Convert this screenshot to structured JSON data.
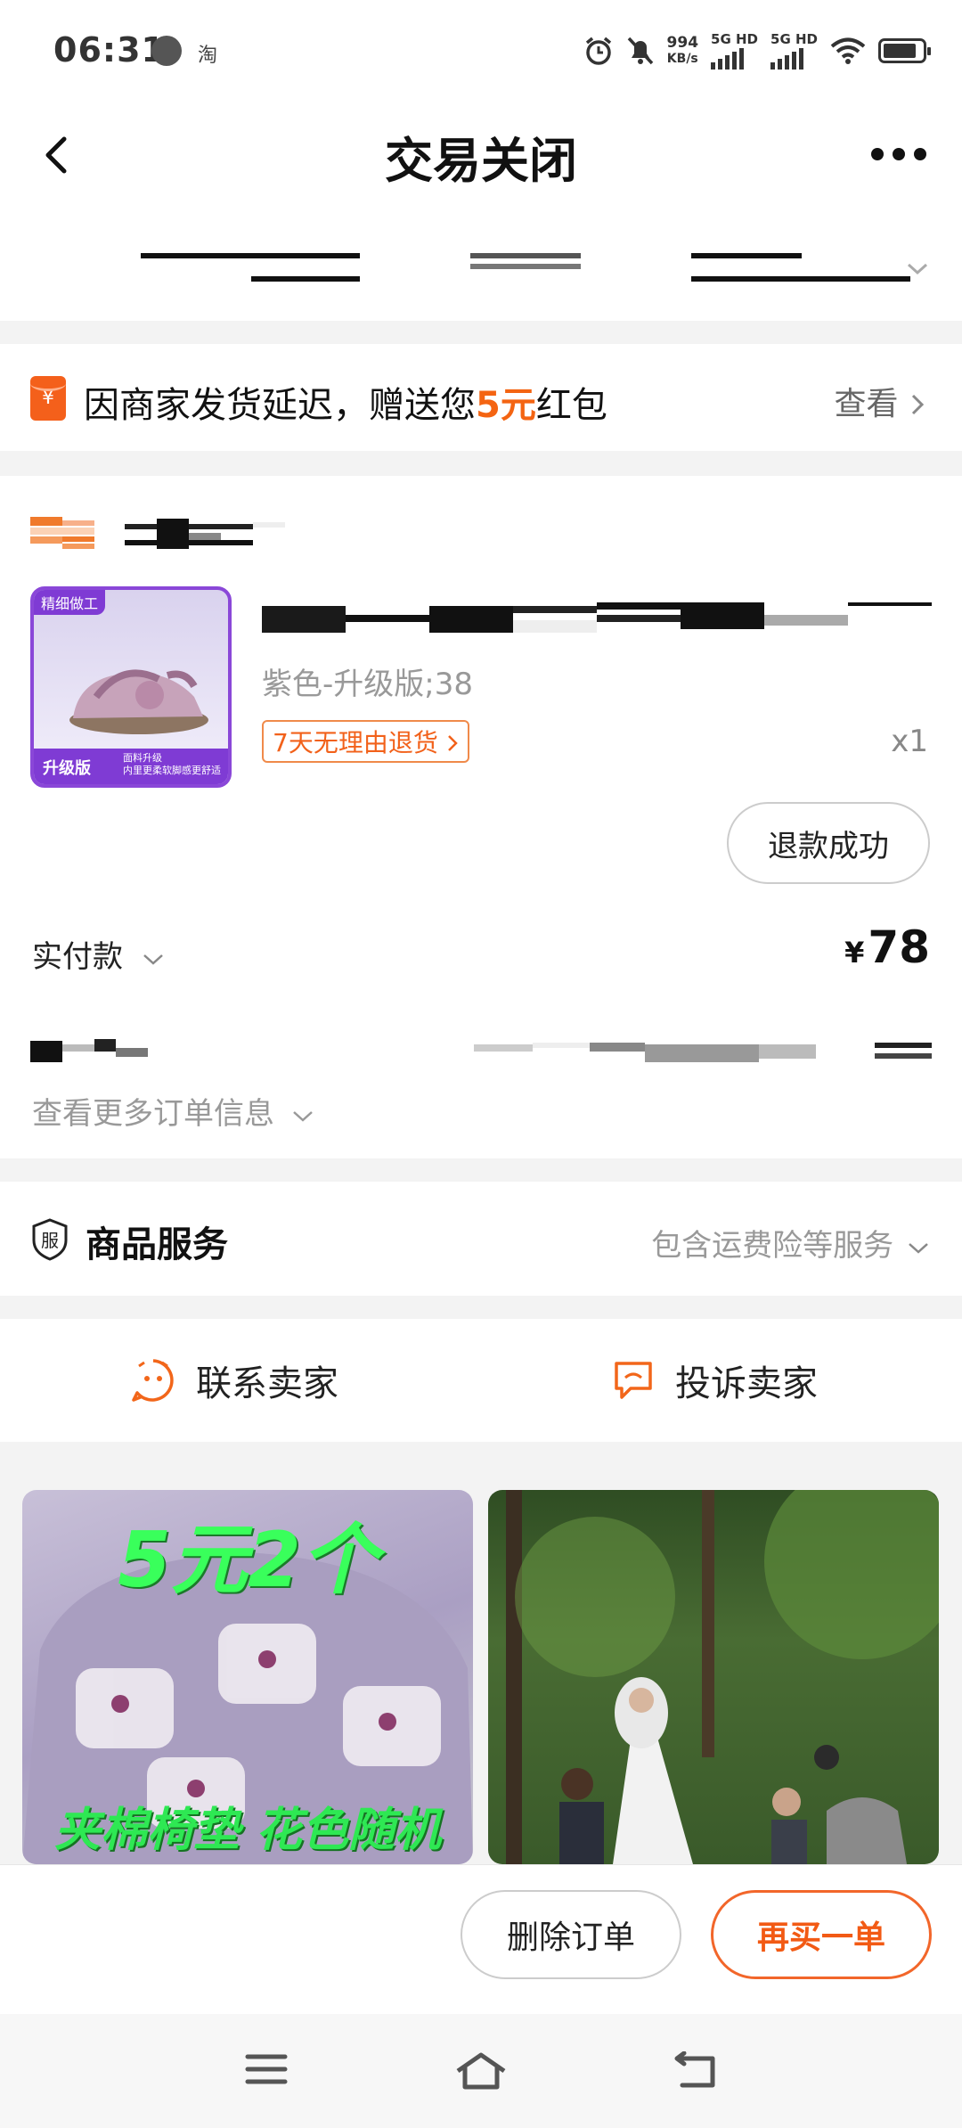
{
  "status_bar": {
    "time": "06:31",
    "app_badge": "淘",
    "net_speed": "994",
    "net_speed_unit": "KB/s",
    "sim1": "5G HD",
    "sim2": "5G HD"
  },
  "nav": {
    "title": "交易关闭"
  },
  "promo": {
    "text_prefix": "因商家发货延迟，赠送您",
    "amount": "5元",
    "text_suffix": "红包",
    "link": "查看",
    "icon_glyph": "¥"
  },
  "order": {
    "thumb_tag_top": "精细做工",
    "thumb_tag_bottom": "升级版",
    "thumb_tag_note_1": "面料升级",
    "thumb_tag_note_2": "内里更柔软脚感更舒适",
    "sku": "紫色-升级版;38",
    "return_policy": "7天无理由退货",
    "quantity": "x1",
    "refund_status": "退款成功",
    "paid_label": "实付款",
    "currency": "¥",
    "paid_amount": "78",
    "more_info": "查看更多订单信息"
  },
  "service": {
    "icon_glyph": "服",
    "title": "商品服务",
    "desc": "包含运费险等服务"
  },
  "contact": {
    "contact_seller": "联系卖家",
    "complain_seller": "投诉卖家"
  },
  "recommend": {
    "card1_top": "5元2个",
    "card1_bottom": "夹棉椅垫 花色随机"
  },
  "actions": {
    "delete_order": "删除订单",
    "buy_again": "再买一单"
  },
  "colors": {
    "accent": "#f46412",
    "purple_tag": "#7f3bd4"
  }
}
